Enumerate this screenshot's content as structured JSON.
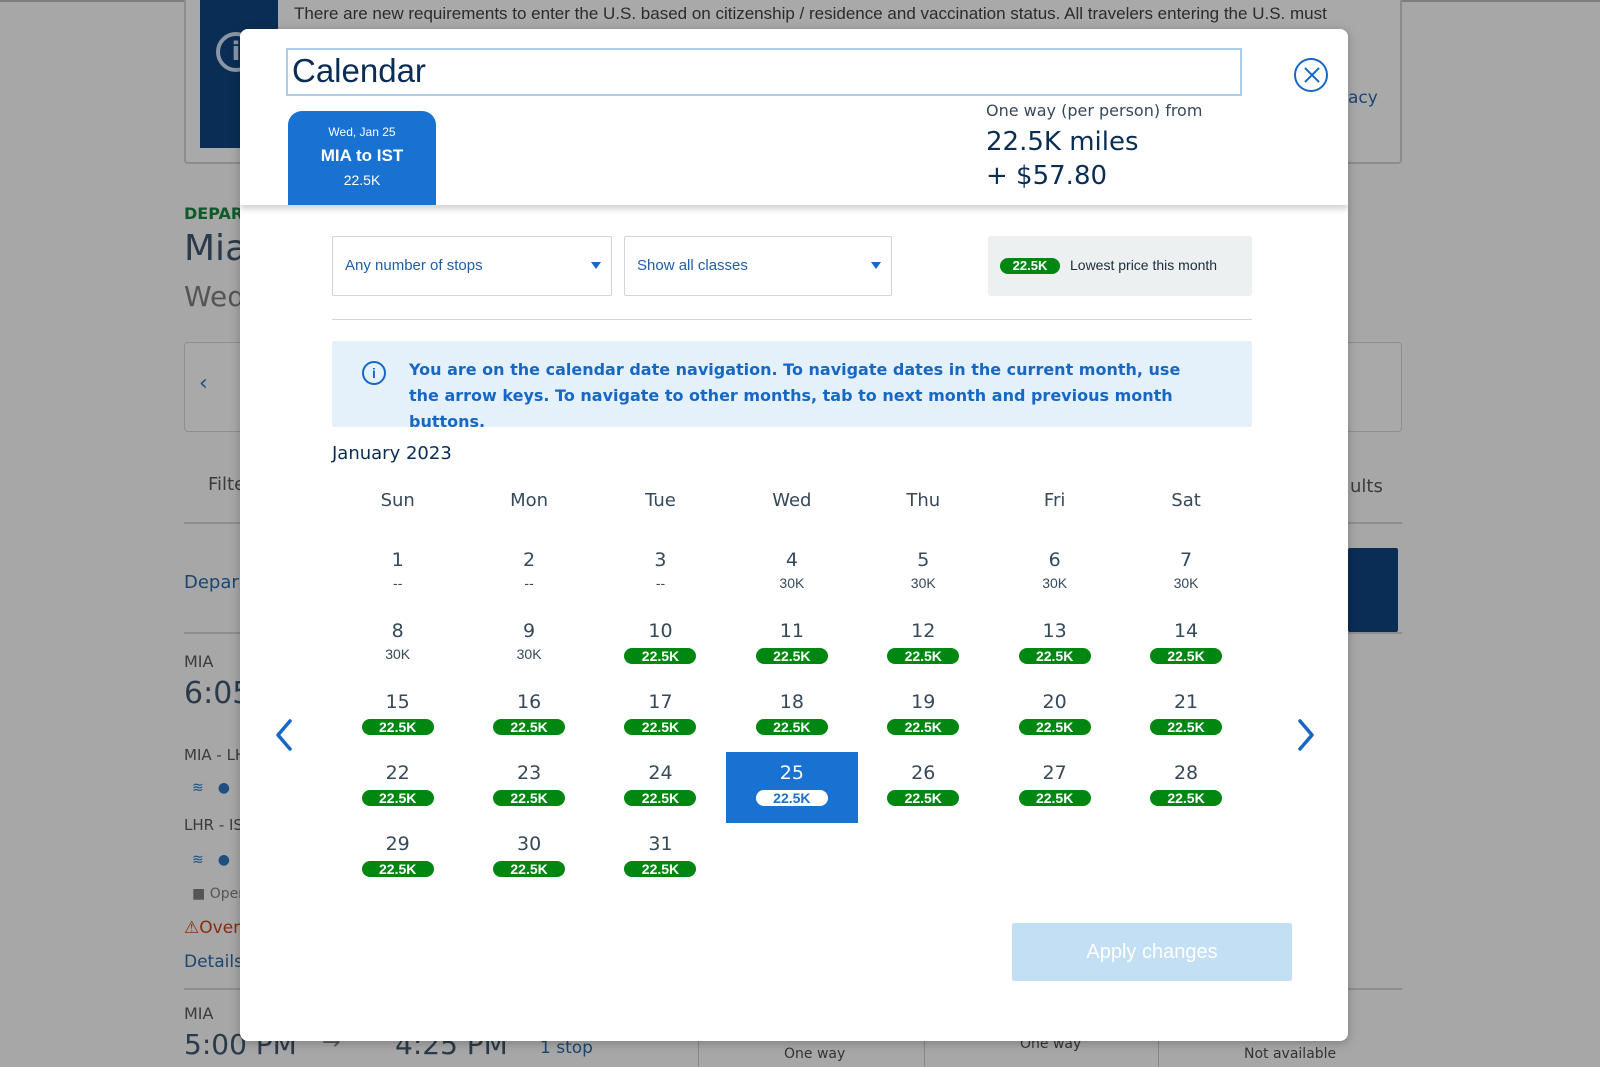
{
  "background_page": {
    "notice_text": "There are new requirements to enter the U.S. based on citizenship / residence and vaccination status. All travelers entering the U.S. must",
    "notice_link_fragment": "acy",
    "depart_label_fragment": "DEPAR",
    "city_fragment": "Mia",
    "date_fragment": "Wed",
    "filter_fragment": "Filte",
    "results_fragment": "ults",
    "depart_link_fragment": "Depar",
    "flight1_origin": "MIA",
    "flight1_time_fragment": "6:05",
    "segment1_fragment": "MIA - LH",
    "segment2_fragment": "LHR - IS",
    "operated_fragment": "Oper",
    "warning_fragment": "Over",
    "details_fragment": "Details",
    "flight2_origin": "MIA",
    "flight2_depart": "5:00 PM",
    "flight2_arrive": "4:25 PM",
    "flight2_stops": "1 stop",
    "col1_label": "One way",
    "col2_label": "One way",
    "col3_label": "Not available"
  },
  "modal": {
    "title": "Calendar",
    "trip_tab": {
      "date": "Wed, Jan 25",
      "route": "MIA to IST",
      "price": "22.5K"
    },
    "fare": {
      "label": "One way (per person) from",
      "miles": "22.5K miles",
      "taxes": "+ $57.80"
    },
    "filters": {
      "stops": "Any number of stops",
      "classes": "Show all classes"
    },
    "legend": {
      "price": "22.5K",
      "label": "Lowest price this month"
    },
    "info_message": "You are on the calendar date navigation. To navigate dates in the current month, use the arrow keys. To navigate to other months, tab to next month and previous month buttons.",
    "month_label": "January 2023",
    "weekdays": [
      "Sun",
      "Mon",
      "Tue",
      "Wed",
      "Thu",
      "Fri",
      "Sat"
    ],
    "start_offset": 0,
    "selected_day": 25,
    "days": [
      {
        "day": "1",
        "price": "--",
        "lowest": false
      },
      {
        "day": "2",
        "price": "--",
        "lowest": false
      },
      {
        "day": "3",
        "price": "--",
        "lowest": false
      },
      {
        "day": "4",
        "price": "30K",
        "lowest": false
      },
      {
        "day": "5",
        "price": "30K",
        "lowest": false
      },
      {
        "day": "6",
        "price": "30K",
        "lowest": false
      },
      {
        "day": "7",
        "price": "30K",
        "lowest": false
      },
      {
        "day": "8",
        "price": "30K",
        "lowest": false
      },
      {
        "day": "9",
        "price": "30K",
        "lowest": false
      },
      {
        "day": "10",
        "price": "22.5K",
        "lowest": true
      },
      {
        "day": "11",
        "price": "22.5K",
        "lowest": true
      },
      {
        "day": "12",
        "price": "22.5K",
        "lowest": true
      },
      {
        "day": "13",
        "price": "22.5K",
        "lowest": true
      },
      {
        "day": "14",
        "price": "22.5K",
        "lowest": true
      },
      {
        "day": "15",
        "price": "22.5K",
        "lowest": true
      },
      {
        "day": "16",
        "price": "22.5K",
        "lowest": true
      },
      {
        "day": "17",
        "price": "22.5K",
        "lowest": true
      },
      {
        "day": "18",
        "price": "22.5K",
        "lowest": true
      },
      {
        "day": "19",
        "price": "22.5K",
        "lowest": true
      },
      {
        "day": "20",
        "price": "22.5K",
        "lowest": true
      },
      {
        "day": "21",
        "price": "22.5K",
        "lowest": true
      },
      {
        "day": "22",
        "price": "22.5K",
        "lowest": true
      },
      {
        "day": "23",
        "price": "22.5K",
        "lowest": true
      },
      {
        "day": "24",
        "price": "22.5K",
        "lowest": true
      },
      {
        "day": "25",
        "price": "22.5K",
        "lowest": true
      },
      {
        "day": "26",
        "price": "22.5K",
        "lowest": true
      },
      {
        "day": "27",
        "price": "22.5K",
        "lowest": true
      },
      {
        "day": "28",
        "price": "22.5K",
        "lowest": true
      },
      {
        "day": "29",
        "price": "22.5K",
        "lowest": true
      },
      {
        "day": "30",
        "price": "22.5K",
        "lowest": true
      },
      {
        "day": "31",
        "price": "22.5K",
        "lowest": true
      }
    ],
    "apply_label": "Apply changes",
    "colors": {
      "primary": "#1972d2",
      "price_pill": "#008712",
      "navy": "#0a2d55",
      "info_bg": "#e4f0fa"
    }
  }
}
